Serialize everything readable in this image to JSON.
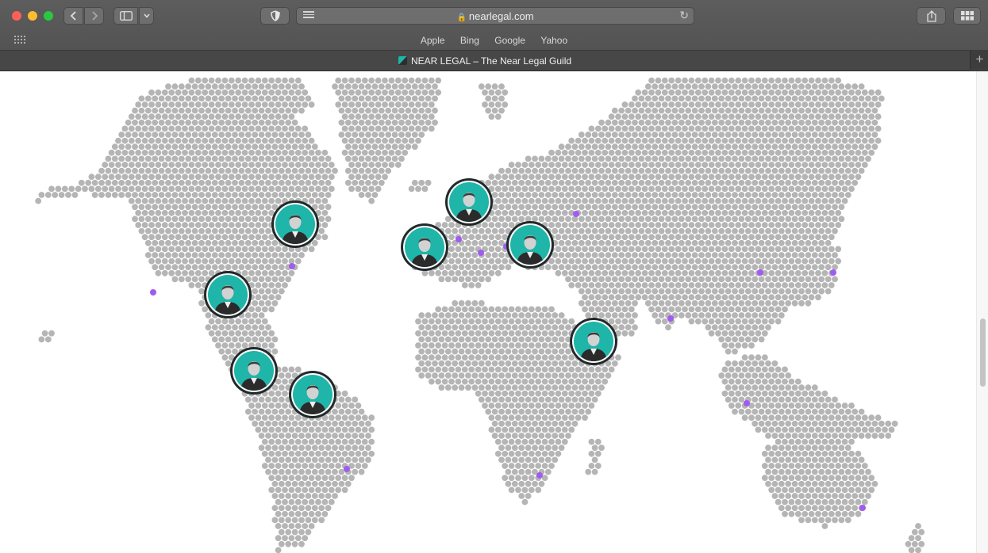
{
  "window": {
    "url": "nearlegal.com",
    "tab_title": "NEAR LEGAL – The Near Legal Guild",
    "favorites": [
      "Apple",
      "Bing",
      "Google",
      "Yahoo"
    ],
    "new_tab_label": "+"
  },
  "icons": {
    "back": "chevron-left-icon",
    "forward": "chevron-right-icon",
    "sidebar": "sidebar-icon",
    "privacy": "shield-icon",
    "reader": "reader-icon",
    "lock": "lock-icon",
    "reload": "reload-icon",
    "share": "share-icon",
    "tabs": "tab-overview-icon",
    "apps": "apps-grid-icon"
  },
  "map": {
    "dot_color": "#b5b5b5",
    "marker_color": "#a05cf0",
    "avatar_bg": "#1fb5a8",
    "avatar_count": 8
  }
}
